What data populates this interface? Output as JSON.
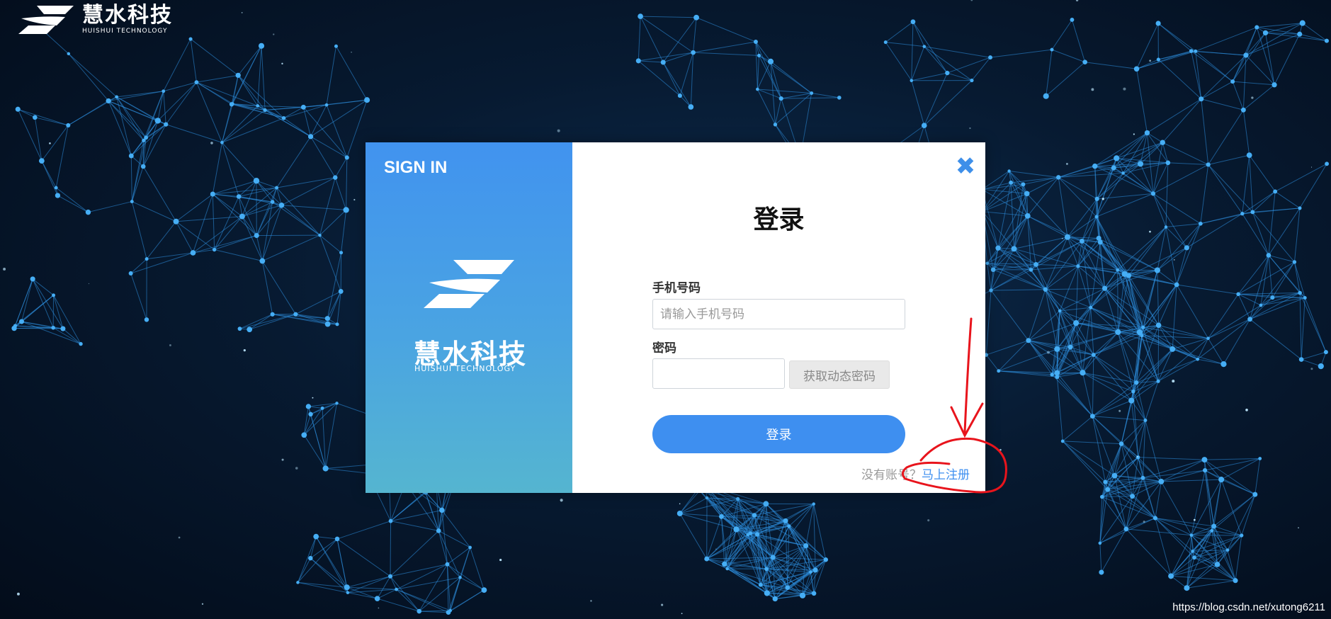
{
  "brand": {
    "name_cn": "慧水科技",
    "name_en": "HUISHUI TECHNOLOGY"
  },
  "dialog": {
    "left_heading": "SIGN IN",
    "title": "登录",
    "close_icon": "close-x-icon",
    "phone": {
      "label": "手机号码",
      "placeholder": "请输入手机号码",
      "value": ""
    },
    "password": {
      "label": "密码",
      "value": "",
      "get_code_label": "获取动态密码"
    },
    "login_button": "登录",
    "register_prompt": "没有账号？",
    "register_link": "马上注册"
  },
  "watermark": "https://blog.csdn.net/xutong6211",
  "colors": {
    "accent": "#3e8ff0",
    "left_gradient_top": "#4193ef",
    "left_gradient_bottom": "#55b5d0",
    "background": "#071a31",
    "annotation": "#e8141c"
  }
}
